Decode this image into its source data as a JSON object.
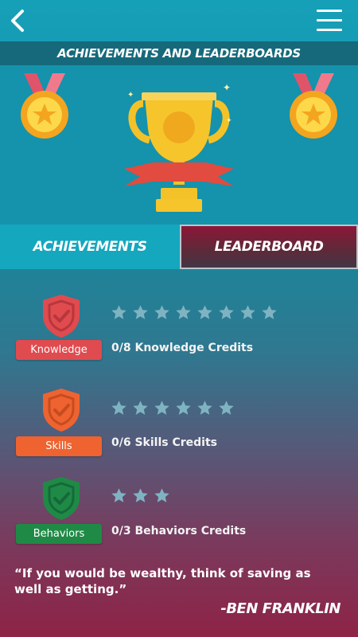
{
  "header": {
    "title": "Achievements and Leaderboards",
    "back_icon": "chevron-left-icon",
    "menu_icon": "hamburger-menu-icon"
  },
  "hero": {
    "trophy_icon": "trophy-icon",
    "medal_icon": "medal-icon"
  },
  "tabs": [
    {
      "label": "Achievements",
      "active": true
    },
    {
      "label": "Leaderboard",
      "active": false
    }
  ],
  "categories": [
    {
      "badge": "Knowledge",
      "credits_text": "0/8 Knowledge Credits",
      "earned": 0,
      "total": 8,
      "color": "#e04b4f"
    },
    {
      "badge": "Skills",
      "credits_text": "0/6 Skills Credits",
      "earned": 0,
      "total": 6,
      "color": "#ee6330"
    },
    {
      "badge": "Behaviors",
      "credits_text": "0/3 Behaviors Credits",
      "earned": 0,
      "total": 3,
      "color": "#1f8a45"
    }
  ],
  "quote": {
    "text": "“If you would be wealthy, think of saving  as well as getting.”",
    "author": "-Ben Franklin"
  },
  "colors": {
    "star_empty": "#7fb3c2",
    "tab_active": "#15a7be",
    "tab_inactive": "#8c1737"
  }
}
